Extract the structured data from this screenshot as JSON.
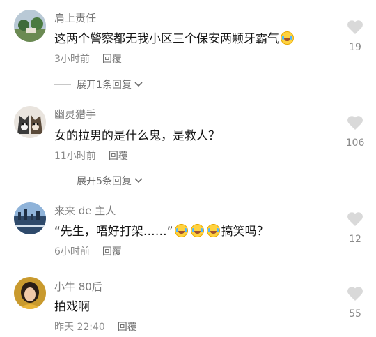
{
  "comments": [
    {
      "username": "肩上责任",
      "text": "这两个警察都无我小区三个保安两颗牙霸气",
      "emoji_after": "laughing-tears-icon",
      "time": "3小时前",
      "reply_label": "回覆",
      "likes": "19",
      "expand_label": "展开1条回复"
    },
    {
      "username": "幽灵猎手",
      "text": "女的拉男的是什么鬼，是救人？",
      "time": "11小时前",
      "reply_label": "回覆",
      "likes": "106",
      "expand_label": "展开5条回复"
    },
    {
      "username": "来来 de 主人",
      "text_before": "“先生，唔好打架……”",
      "emojis": [
        "laughing-tears-icon",
        "laughing-tears-icon",
        "laughing-tears-icon"
      ],
      "text_after": "搞笑吗？",
      "time": "6小时前",
      "reply_label": "回覆",
      "likes": "12"
    },
    {
      "username": "小牛 80后",
      "text": "拍戏啊",
      "time": "昨天 22:40",
      "reply_label": "回覆",
      "likes": "55"
    }
  ],
  "colors": {
    "username": "#7a7a7a",
    "text": "#161616",
    "meta": "#8a8a8a",
    "heart": "#d9d9d9"
  }
}
